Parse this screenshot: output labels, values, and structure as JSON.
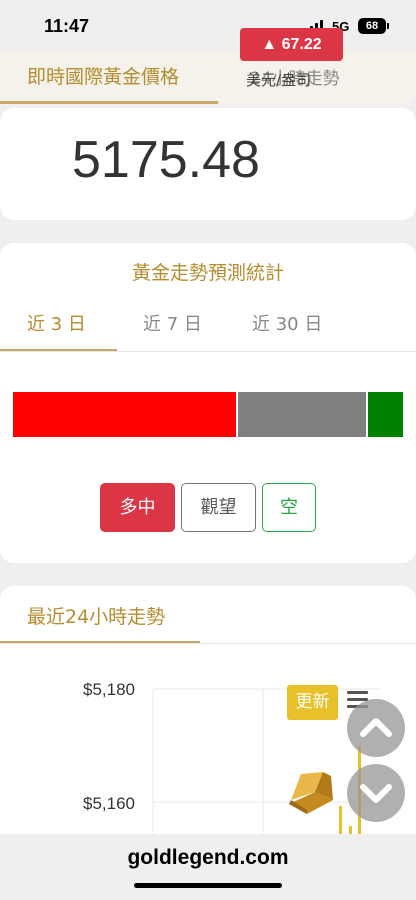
{
  "status": {
    "time": "11:47",
    "network": "5G",
    "battery": "68"
  },
  "nav": {
    "tabs": [
      {
        "label": "即時國際黃金價格",
        "active": true
      },
      {
        "label": "24小時走勢",
        "active": false
      }
    ]
  },
  "price": {
    "value": "5175.48",
    "change": "▲ 67.22",
    "unit": "美元/盎司",
    "change_color": "#dc3545"
  },
  "forecast": {
    "title": "黃金走勢預測統計",
    "periods": [
      {
        "label": "近 3 日",
        "active": true
      },
      {
        "label": "近 7 日",
        "active": false
      },
      {
        "label": "近 30 日",
        "active": false
      }
    ],
    "distribution": [
      {
        "name": "bull",
        "color": "#ff0000",
        "fraction": 0.575
      },
      {
        "name": "neutral",
        "color": "#808080",
        "fraction": 0.335
      },
      {
        "name": "bear",
        "color": "#008000",
        "fraction": 0.09
      }
    ],
    "buttons": {
      "bull": "多中",
      "watch": "觀望",
      "bear": "空"
    }
  },
  "trend": {
    "title": "最近24小時走勢",
    "update_label": "更新"
  },
  "chart_data": {
    "type": "line",
    "ylabels": [
      "$5,180",
      "$5,160"
    ],
    "yvalues": [
      5180,
      5160
    ]
  },
  "footer": {
    "site": "goldlegend.com"
  },
  "colors": {
    "accent": "#b58c2f",
    "red": "#dc3545",
    "green": "#28a745"
  }
}
